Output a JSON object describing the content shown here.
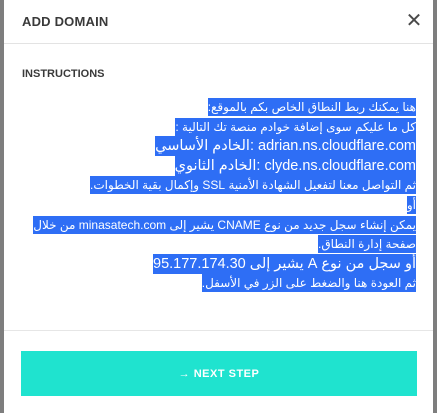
{
  "modal": {
    "title": "ADD DOMAIN",
    "close_symbol": "✕"
  },
  "instructions": {
    "heading": "INSTRUCTIONS",
    "lines": [
      "هنا يمكنك ربط النطاق الخاص بكم بالموقع:",
      "كل ما عليكم سوى إضافة خوادم منصة تك التالية :",
      "adrian.ns.cloudflare.com :الخادم الأساسي",
      "clyde.ns.cloudflare.com :الخادم الثانوي",
      "ثم التواصل معنا لتفعيل الشهادة الأمنية SSL وإكمال بقية الخطوات.",
      "أو",
      "يمكن إنشاء سجل جديد من نوع CNAME يشير إلى minasatech.com من خلال",
      "صفحة إدارة النطاق.",
      "أو سجل من نوع A يشير إلى 95.177.174.30",
      "ثم العودة هنا والضغط على الزر في الأسفل."
    ]
  },
  "footer": {
    "next_label": "→ NEXT STEP"
  },
  "colors": {
    "accent": "#1fe3cf",
    "selection": "#2e6ef5",
    "overlay": "#7e7e7e"
  }
}
